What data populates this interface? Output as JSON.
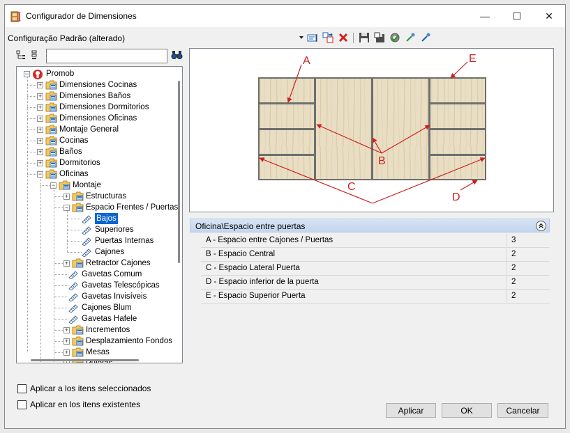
{
  "window": {
    "title": "Configurador de Dimensiones",
    "minimize_glyph": "—",
    "maximize_glyph": "☐",
    "close_glyph": "✕"
  },
  "config": {
    "label": "Configuração Padrão (alterado)"
  },
  "toolbar": {
    "icons": [
      "dropdown-arrow-icon",
      "edit-config-icon",
      "copy-config-icon",
      "delete-icon",
      "save-icon",
      "save-as-icon",
      "settings-check-icon",
      "import-icon",
      "export-icon"
    ]
  },
  "search": {
    "value": "",
    "placeholder": ""
  },
  "tree": {
    "nodes": [
      {
        "label": "Promob",
        "level": 0,
        "kind": "root",
        "expanded": true
      },
      {
        "label": "Dimensiones Cocinas",
        "level": 1,
        "kind": "folder",
        "expanded": false
      },
      {
        "label": "Dimensiones Baños",
        "level": 1,
        "kind": "folder",
        "expanded": false
      },
      {
        "label": "Dimensiones Dormitorios",
        "level": 1,
        "kind": "folder",
        "expanded": false
      },
      {
        "label": "Dimensiones Oficinas",
        "level": 1,
        "kind": "folder",
        "expanded": false
      },
      {
        "label": "Montaje General",
        "level": 1,
        "kind": "folder",
        "expanded": false
      },
      {
        "label": "Cocinas",
        "level": 1,
        "kind": "folder",
        "expanded": false
      },
      {
        "label": "Baños",
        "level": 1,
        "kind": "folder",
        "expanded": false
      },
      {
        "label": "Dormitorios",
        "level": 1,
        "kind": "folder",
        "expanded": false
      },
      {
        "label": "Oficinas",
        "level": 1,
        "kind": "folder",
        "expanded": true
      },
      {
        "label": "Montaje",
        "level": 2,
        "kind": "folder",
        "expanded": true
      },
      {
        "label": "Estructuras",
        "level": 3,
        "kind": "folder",
        "expanded": false
      },
      {
        "label": "Espacio Frentes / Puertas",
        "level": 3,
        "kind": "folder",
        "expanded": true
      },
      {
        "label": "Bajos",
        "level": 4,
        "kind": "leaf",
        "selected": true
      },
      {
        "label": "Superiores",
        "level": 4,
        "kind": "leaf"
      },
      {
        "label": "Puertas Internas",
        "level": 4,
        "kind": "leaf"
      },
      {
        "label": "Cajones",
        "level": 4,
        "kind": "leaf"
      },
      {
        "label": "Retractor Cajones",
        "level": 3,
        "kind": "folder",
        "expanded": false
      },
      {
        "label": "Gavetas Comum",
        "level": 3,
        "kind": "leaf"
      },
      {
        "label": "Gavetas Telescópicas",
        "level": 3,
        "kind": "leaf"
      },
      {
        "label": "Gavetas Invisíveis",
        "level": 3,
        "kind": "leaf"
      },
      {
        "label": "Cajones Blum",
        "level": 3,
        "kind": "leaf"
      },
      {
        "label": "Gavetas Hafele",
        "level": 3,
        "kind": "leaf"
      },
      {
        "label": "Incrementos",
        "level": 3,
        "kind": "folder",
        "expanded": false
      },
      {
        "label": "Desplazamiento Fondos",
        "level": 3,
        "kind": "folder",
        "expanded": false
      },
      {
        "label": "Mesas",
        "level": 3,
        "kind": "folder",
        "expanded": false
      },
      {
        "label": "Puletas",
        "level": 3,
        "kind": "folder",
        "expanded": false
      }
    ]
  },
  "diagram": {
    "labels": [
      "A",
      "B",
      "C",
      "D",
      "E"
    ],
    "wood_color": "#e8dcc0",
    "line_color": "#cc1f1f"
  },
  "properties": {
    "group_title": "Oficina\\Espacio entre puertas",
    "rows": [
      {
        "name": "A - Espacio entre Cajones / Puertas",
        "value": "3"
      },
      {
        "name": "B - Espacio Central",
        "value": "2"
      },
      {
        "name": "C - Espacio Lateral Puerta",
        "value": "2"
      },
      {
        "name": "D - Espacio inferior de la puerta",
        "value": "2"
      },
      {
        "name": "E - Espacio Superior Puerta",
        "value": "2"
      }
    ]
  },
  "options": {
    "apply_selected": "Aplicar a los itens seleccionados",
    "apply_existing": "Aplicar en los itens existentes"
  },
  "buttons": {
    "apply": "Aplicar",
    "ok": "OK",
    "cancel": "Cancelar"
  }
}
